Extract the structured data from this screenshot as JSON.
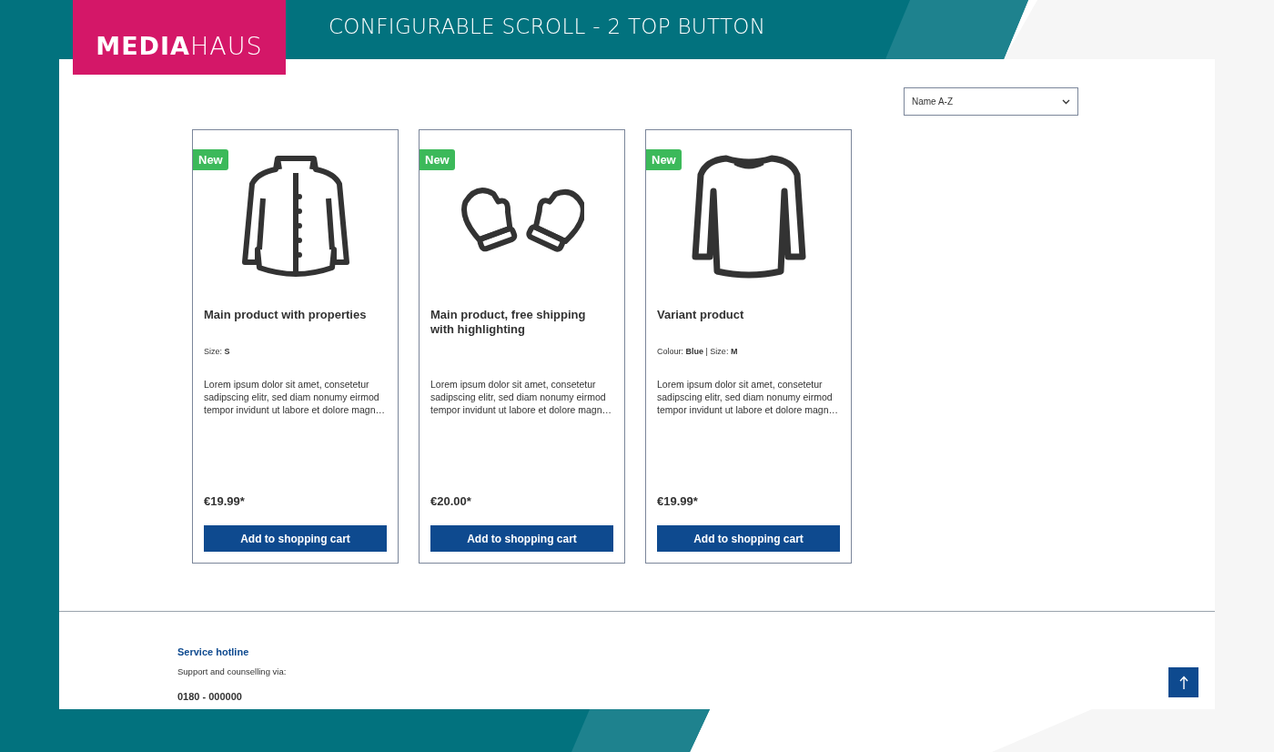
{
  "header": {
    "logo": "**MEDIA**HAUS",
    "title": "CONFIGURABLE SCROLL - 2 TOP BUTTON"
  },
  "sorting": {
    "value": "Name A-Z"
  },
  "products": [
    {
      "badge": "New",
      "name": "Main product with properties",
      "properties": "Size: **S**",
      "description": "Lorem ipsum dolor sit amet, consetetur sadipscing elitr, sed diam nonumy eirmod tempor invidunt ut labore et dolore magn…",
      "price": "€19.99*",
      "button": "Add to shopping cart"
    },
    {
      "badge": "New",
      "name": "Main product, free shipping with highlighting",
      "description": "Lorem ipsum dolor sit amet, consetetur sadipscing elitr, sed diam nonumy eirmod tempor invidunt ut labore et dolore magn…",
      "price": "€20.00*",
      "button": "Add to shopping cart"
    },
    {
      "badge": "New",
      "name": "Variant product",
      "properties": "Colour: **Blue** | Size: **M**",
      "description": "Lorem ipsum dolor sit amet, consetetur sadipscing elitr, sed diam nonumy eirmod tempor invidunt ut labore et dolore magn…",
      "price": "€19.99*",
      "button": "Add to shopping cart"
    }
  ],
  "footer": {
    "heading": "Service hotline",
    "text": "Support and counselling via:",
    "phone": "0180 - 000000"
  }
}
